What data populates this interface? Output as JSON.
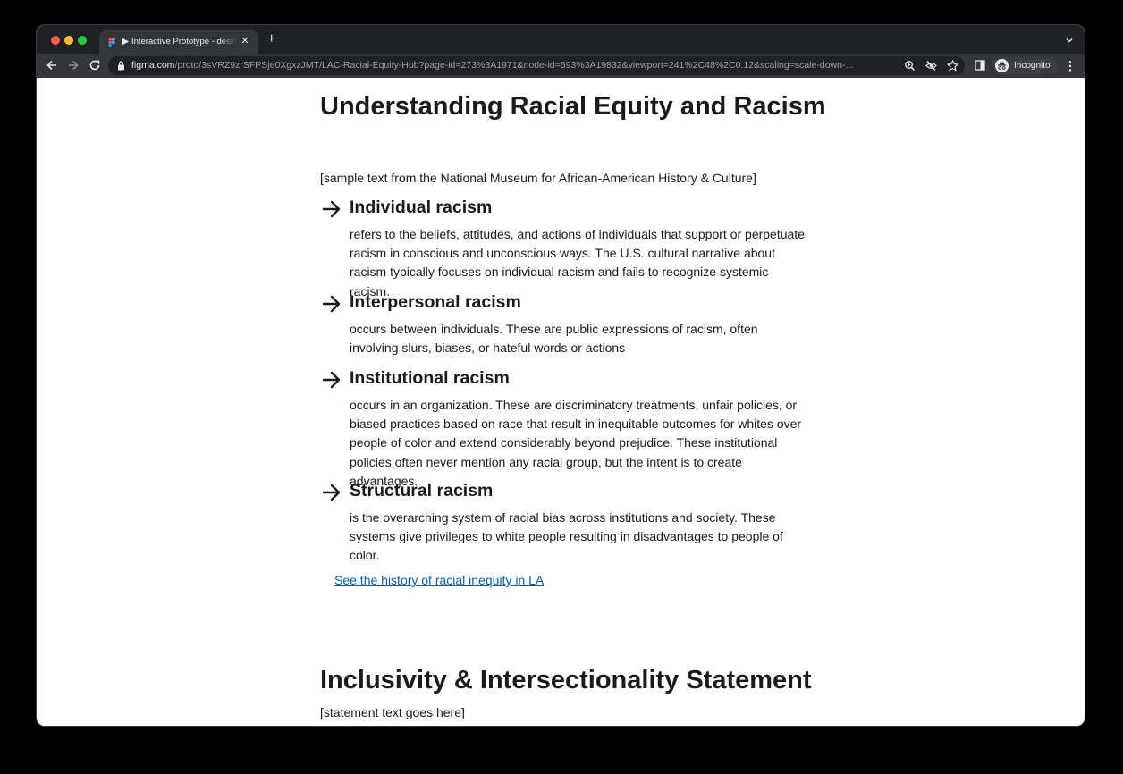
{
  "browser": {
    "tab": {
      "title": "▶ Interactive Prototype - desktop"
    },
    "omnibox": {
      "host": "figma.com",
      "path": "/proto/3sVRZ9zrSFPSje0XgxzJMT/LAC-Racial-Equity-Hub?page-id=273%3A1971&node-id=593%3A19832&viewport=241%2C48%2C0.12&scaling=scale-down-..."
    },
    "profile_label": "Incognito"
  },
  "page": {
    "title": "Understanding Racial Equity and Racism",
    "source_note": "[sample text from the National Museum for African-American History & Culture]",
    "terms": [
      {
        "heading": "Individual racism",
        "description": "refers to the beliefs, attitudes, and actions of individuals that support or perpetuate racism in conscious and unconscious ways. The U.S. cultural narrative about racism typically focuses on individual racism and fails to recognize systemic racism."
      },
      {
        "heading": "Interpersonal racism",
        "description": "occurs between individuals. These are public expressions of racism, often involving slurs, biases, or hateful words or actions"
      },
      {
        "heading": "Institutional racism",
        "description": "occurs in an organization. These are discriminatory treatments, unfair policies, or biased practices based on race that result in inequitable outcomes for whites over people of color and extend considerably beyond prejudice. These institutional policies often never mention any racial group, but the intent is to create advantages."
      },
      {
        "heading": "Structural racism",
        "description": "is the overarching system of racial bias across institutions and society. These systems give privileges to white people resulting in disadvantages to people of color."
      }
    ],
    "history_link": "See the history of racial inequity in LA",
    "second_title": "Inclusivity & Intersectionality Statement",
    "statement_text": "[statement text goes here]"
  },
  "icons": {
    "term_bullet": "arrow-right-icon",
    "tab_favicon": "figma-icon"
  },
  "colors": {
    "chrome_dark": "#202124",
    "chrome_toolbar": "#35363a",
    "link": "#0b5fad",
    "text": "#1a1a1a"
  }
}
